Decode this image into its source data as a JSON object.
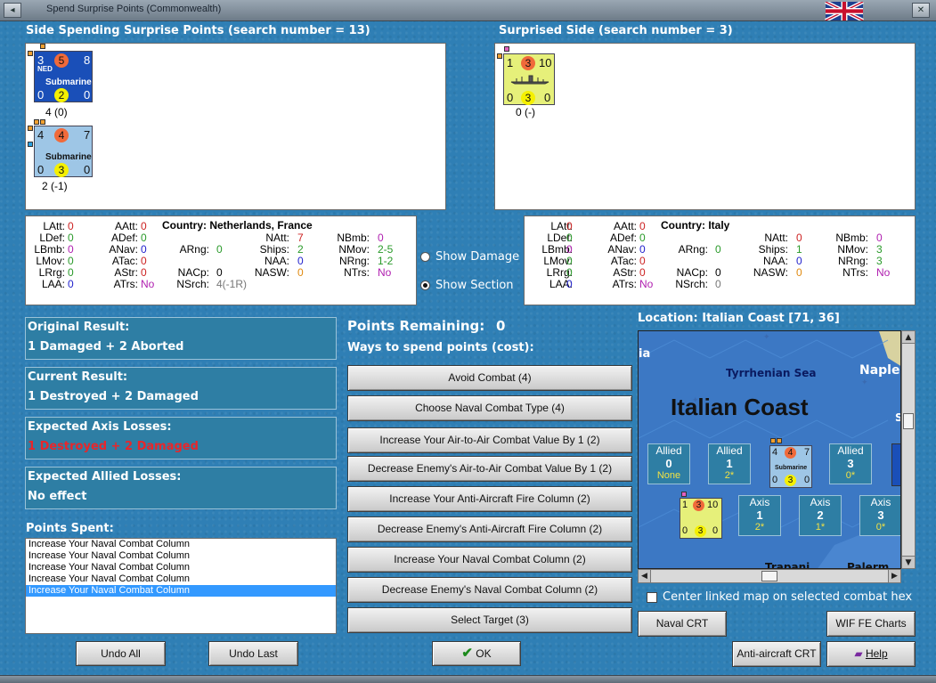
{
  "window": {
    "title": "Spend Surprise Points (Commonwealth)"
  },
  "left_side": {
    "heading": "Side Spending Surprise Points (search number = 13)",
    "units": [
      {
        "top_left": "3",
        "top_mid": "5",
        "top_right": "8",
        "nation": "NED",
        "type": "Submarine",
        "bot_left": "0",
        "bot_mid": "2",
        "bot_right": "0",
        "caption": "4 (0)"
      },
      {
        "top_left": "4",
        "top_mid": "4",
        "top_right": "7",
        "nation": "",
        "type": "Submarine",
        "bot_left": "0",
        "bot_mid": "3",
        "bot_right": "0",
        "caption": "2 (-1)"
      }
    ]
  },
  "right_side": {
    "heading": "Surprised Side (search number = 3)",
    "units": [
      {
        "top_left": "1",
        "top_mid": "3",
        "top_right": "10",
        "bot_left": "0",
        "bot_mid": "3",
        "bot_right": "0",
        "caption": "0 (-)"
      }
    ]
  },
  "left_stats": {
    "country": "Country: Netherlands, France",
    "LAtt": "0",
    "LDef": "0",
    "LBmb": "0",
    "LMov": "0",
    "LRrg": "0",
    "LAA": "0",
    "AAtt": "0",
    "ADef": "0",
    "ANav": "0",
    "ATac": "0",
    "AStr": "0",
    "ATrs": "No",
    "ARng": "0",
    "NACp": "0",
    "NAtt": "7",
    "Ships": "2",
    "NAA": "0",
    "NASW": "0",
    "NSrch": "4(-1R)",
    "NBmb": "0",
    "NMov": "2-5",
    "NRng": "1-2",
    "NTrs": "No"
  },
  "right_stats": {
    "country": "Country: Italy",
    "LAtt": "0",
    "LDef": "0",
    "LBmb": "0",
    "LMov": "0",
    "LRrg": "0",
    "LAA": "0",
    "AAtt": "0",
    "ADef": "0",
    "ANav": "0",
    "ATac": "0",
    "AStr": "0",
    "ATrs": "No",
    "ARng": "0",
    "NACp": "0",
    "NAtt": "0",
    "Ships": "1",
    "NAA": "0",
    "NASW": "0",
    "NSrch": "0",
    "NBmb": "0",
    "NMov": "3",
    "NRng": "3",
    "NTrs": "No"
  },
  "toggles": {
    "show_damage": "Show Damage",
    "show_section": "Show Section"
  },
  "results": {
    "original_h": "Original Result:",
    "original_b": "1 Damaged + 2 Aborted",
    "current_h": "Current Result:",
    "current_b": "1 Destroyed + 2 Damaged",
    "axis_h": "Expected Axis Losses:",
    "axis_b": "1 Destroyed + 2 Damaged",
    "allied_h": "Expected Allied Losses:",
    "allied_b": "No effect"
  },
  "points_spent": {
    "label": "Points Spent:",
    "items": [
      "Increase Your Naval Combat Column",
      "Increase Your Naval Combat Column",
      "Increase Your Naval Combat Column",
      "Increase Your Naval Combat Column",
      "Increase Your Naval Combat Column"
    ]
  },
  "spend": {
    "remaining_label": "Points Remaining:",
    "remaining_value": "0",
    "ways_label": "Ways to spend points (cost):",
    "options": [
      "Avoid Combat (4)",
      "Choose Naval Combat Type (4)",
      "Increase Your Air-to-Air Combat Value By 1 (2)",
      "Decrease Enemy's Air-to-Air Combat Value By 1 (2)",
      "Increase Your Anti-Aircraft Fire Column (2)",
      "Decrease Enemy's Anti-Aircraft Fire Column (2)",
      "Increase Your Naval Combat Column (2)",
      "Decrease Enemy's Naval Combat Column (2)",
      "Select Target (3)"
    ]
  },
  "location": {
    "label": "Location: Italian Coast [71, 36]",
    "sea": "Tyrrhenian Sea",
    "area": "Italian Coast",
    "place_left": "ia",
    "place_right": "Naple",
    "place_right2": "S",
    "place_bottom1": "Trapani",
    "place_bottom2": "Palerm",
    "boxes": [
      {
        "side": "Allied",
        "num": "0",
        "sub": "None"
      },
      {
        "side": "Allied",
        "num": "1",
        "sub": "2*"
      },
      {
        "side": "Allied",
        "num": "3",
        "sub": "0*"
      },
      {
        "side": "Axis",
        "num": "1",
        "sub": "2*"
      },
      {
        "side": "Axis",
        "num": "2",
        "sub": "1*"
      },
      {
        "side": "Axis",
        "num": "3",
        "sub": "0*"
      }
    ],
    "map_unit_allied": {
      "tl": "4",
      "tm": "4",
      "tr": "7",
      "type": "Submarine",
      "bl": "0",
      "bm": "3",
      "br": "0"
    },
    "map_unit_axis": {
      "tl": "1",
      "tm": "3",
      "tr": "10",
      "bl": "0",
      "bm": "3",
      "br": "0"
    },
    "center_label": "Center linked map on selected combat hex"
  },
  "buttons": {
    "undo_all": "Undo All",
    "undo_last": "Undo Last",
    "ok": "OK",
    "naval_crt": "Naval CRT",
    "wif_charts": "WIF FE Charts",
    "aa_crt": "Anti-aircraft CRT",
    "help": "Help"
  },
  "colors": {
    "red_text": "#e8262b",
    "value_green": "#2a9a2a",
    "value_red": "#cc2222",
    "value_blue": "#2222cc",
    "value_magenta": "#b020b0"
  }
}
